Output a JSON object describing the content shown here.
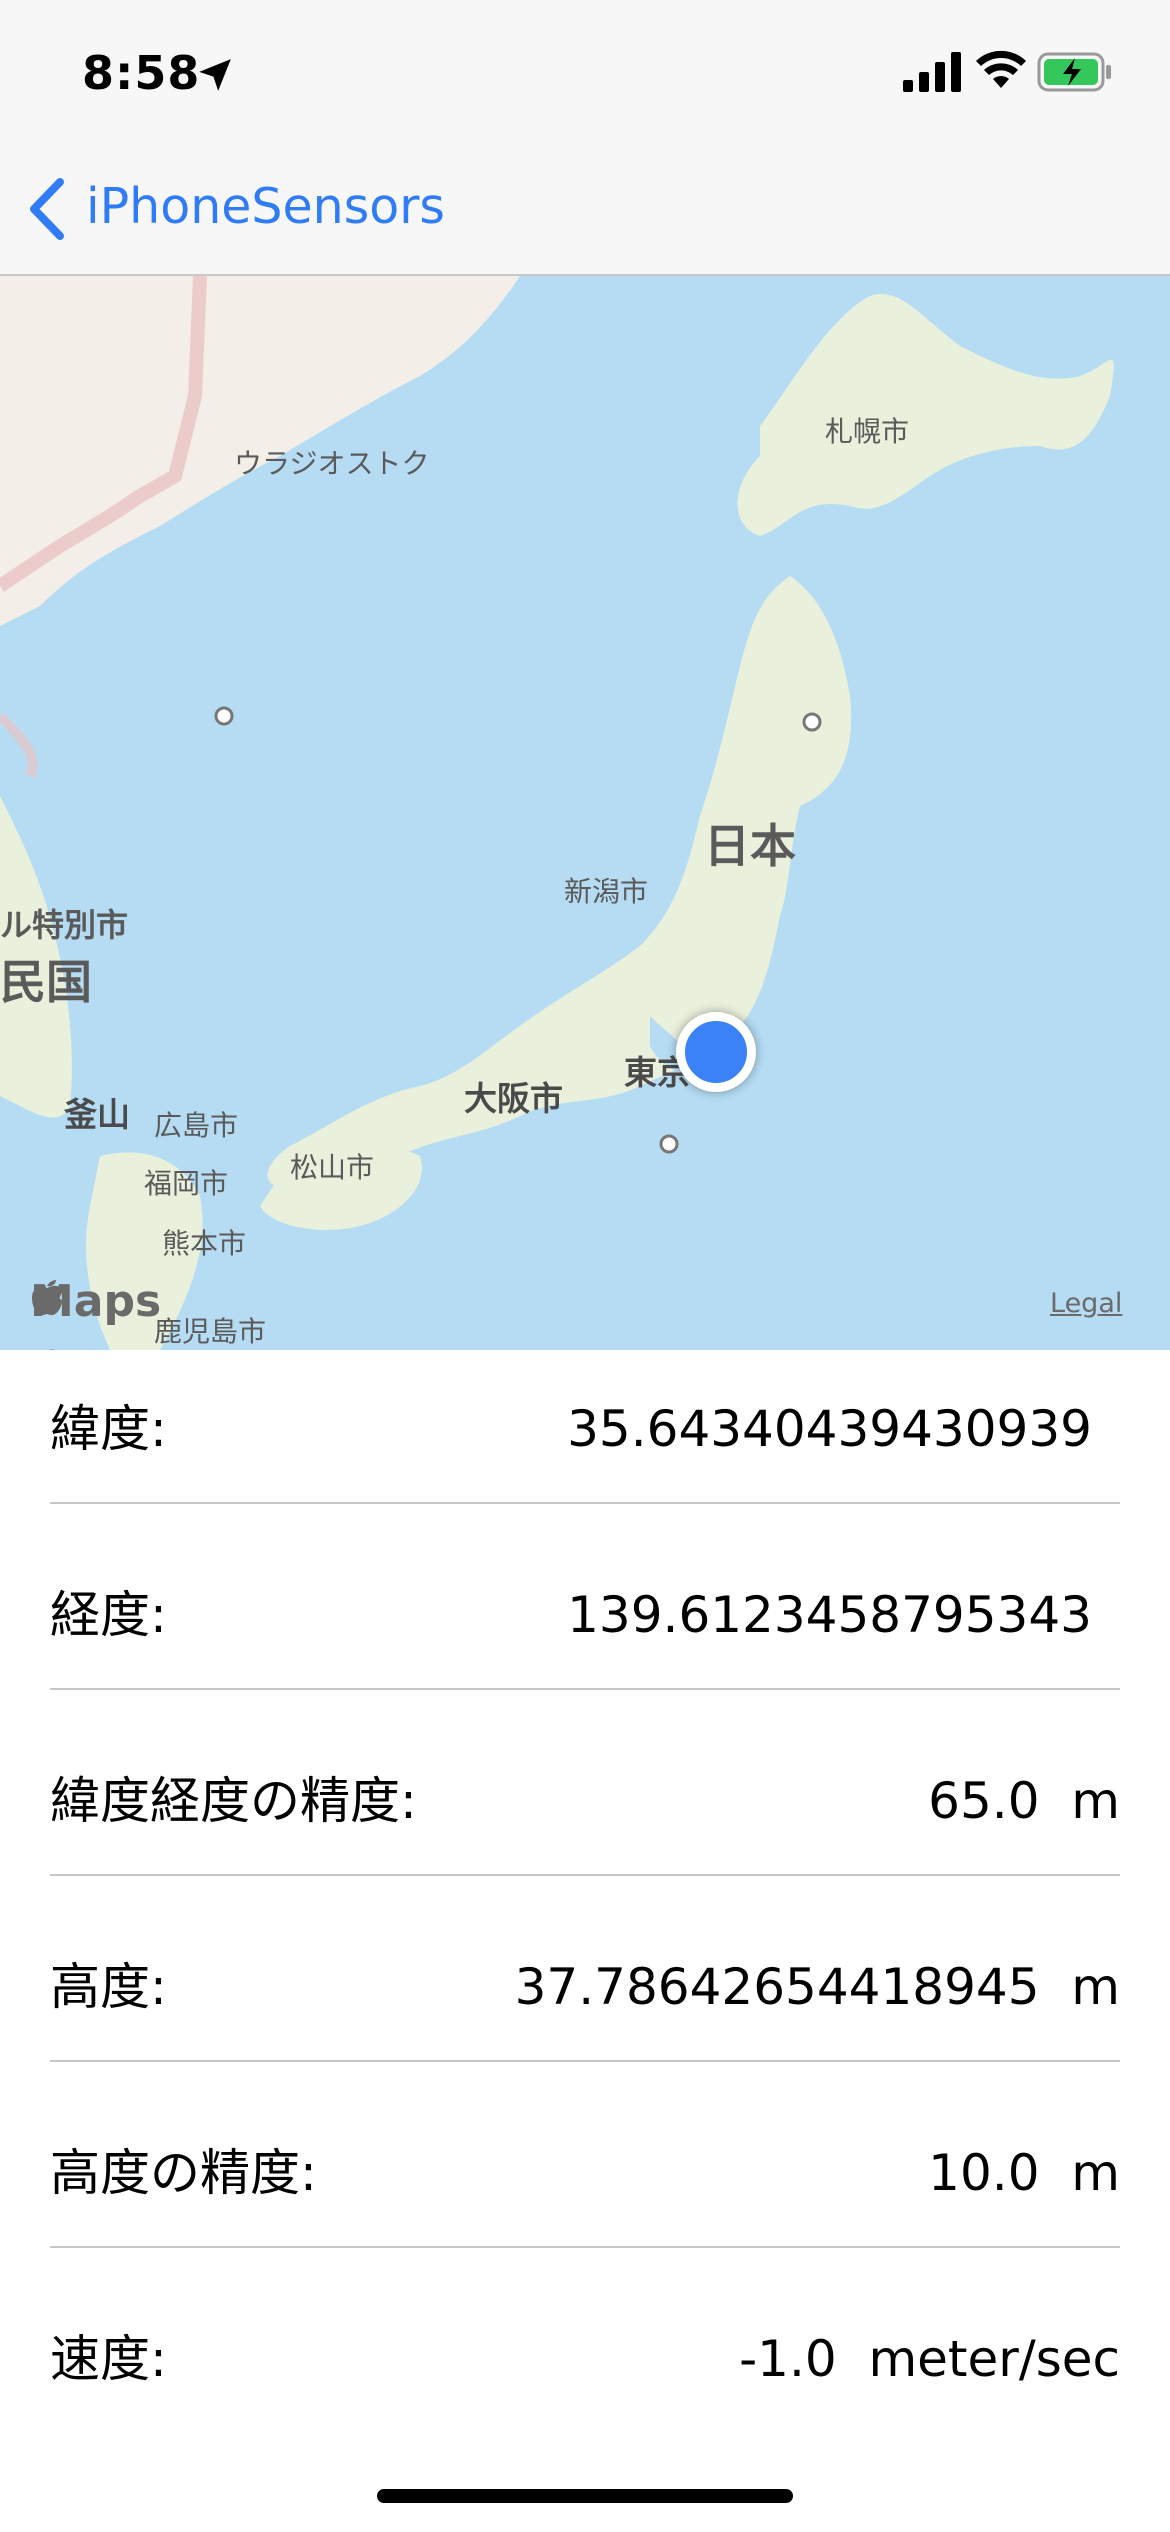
{
  "status_bar": {
    "time": "8:58"
  },
  "nav": {
    "back_label": "iPhoneSensors"
  },
  "map": {
    "labels": {
      "vladivostok": "ウラジオストク",
      "sapporo": "札幌市",
      "japan": "日本",
      "niigata": "新潟市",
      "seoul_partial": "ル特別市",
      "korea_partial": "民国",
      "busan": "釜山",
      "tokyo": "東京",
      "osaka": "大阪市",
      "hiroshima": "広島市",
      "matsuyama": "松山市",
      "fukuoka": "福岡市",
      "kumamoto": "熊本市",
      "kagoshima": "鹿児島市"
    },
    "attribution": "Maps",
    "legal": "Legal"
  },
  "rows": [
    {
      "label": "緯度:",
      "value": "35.64340439430939"
    },
    {
      "label": "経度:",
      "value": "139.6123458795343"
    },
    {
      "label": "緯度経度の精度:",
      "value": "65.0  m"
    },
    {
      "label": "高度:",
      "value": "37.78642654418945  m"
    },
    {
      "label": "高度の精度:",
      "value": "10.0  m"
    },
    {
      "label": "速度:",
      "value": "-1.0  meter/sec"
    }
  ],
  "colors": {
    "accent": "#2f7cf6",
    "water": "#b5dcf3",
    "land": "#e9f0dc",
    "user_location": "#3b82f6"
  }
}
